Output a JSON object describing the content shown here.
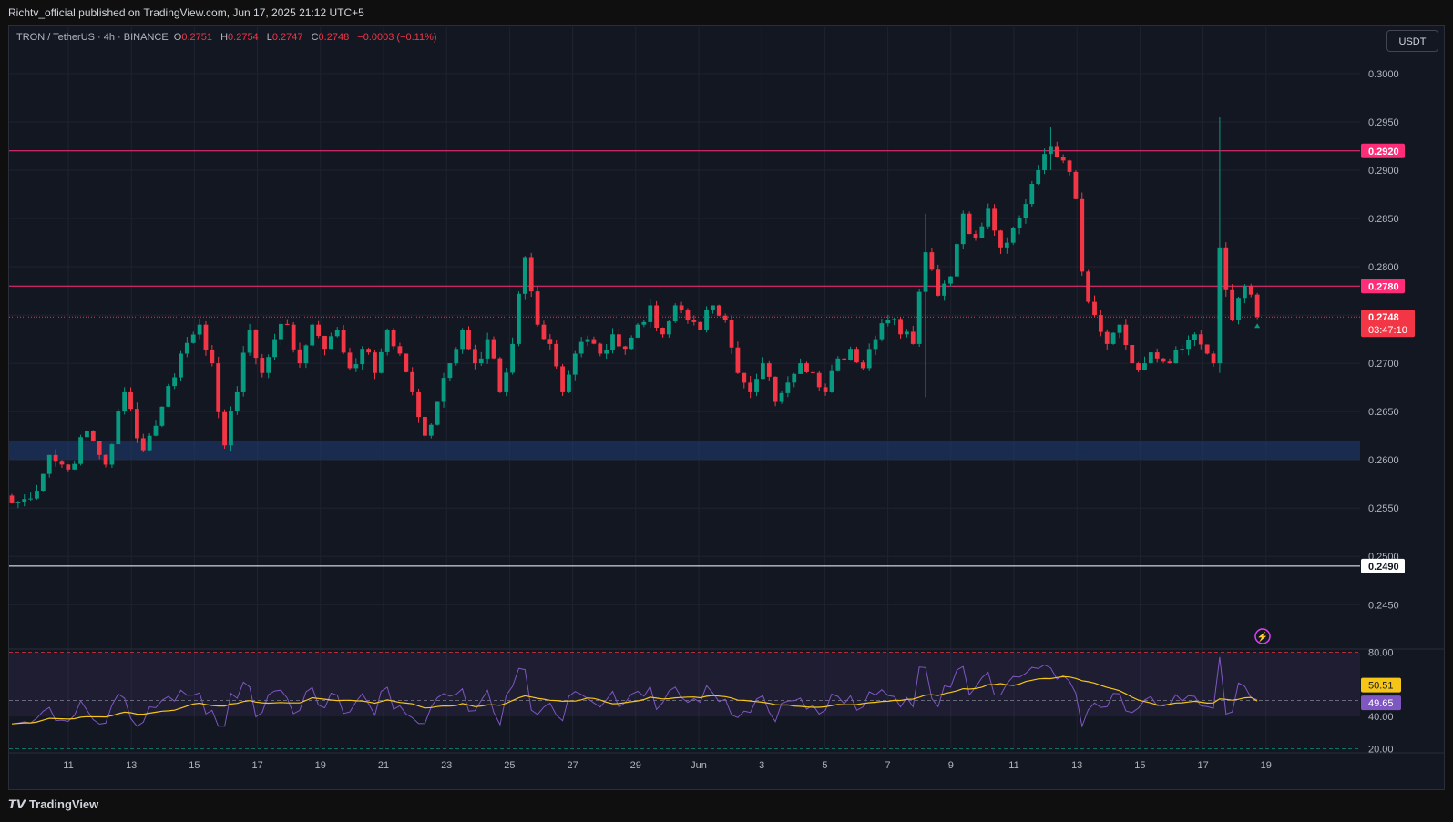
{
  "header": {
    "published": "Richtv_official published on TradingView.com, Jun 17, 2025 21:12 UTC+5"
  },
  "legend": {
    "symbol": "TRON / TetherUS · 4h · BINANCE",
    "o_label": "O",
    "o": "0.2751",
    "h_label": "H",
    "h": "0.2754",
    "l_label": "L",
    "l": "0.2747",
    "c_label": "C",
    "c": "0.2748",
    "change": "−0.0003 (−0.11%)"
  },
  "currency": "USDT",
  "footer": {
    "brand": "TradingView"
  },
  "colors": {
    "up": "#089981",
    "down": "#f23645",
    "bg": "#131722",
    "resistance": "#ff2d78",
    "support_zone": "#1e3a6e",
    "rsi": "#7e57c2",
    "rsi_ma": "#f5c518"
  },
  "chart_data": {
    "type": "candlestick",
    "price_axis": {
      "ylim": [
        0.2405,
        0.3048
      ],
      "ticks": [
        "0.3000",
        "0.2950",
        "0.2900",
        "0.2850",
        "0.2800",
        "0.2750",
        "0.2700",
        "0.2650",
        "0.2600",
        "0.2550",
        "0.2500",
        "0.2450"
      ],
      "labels": [
        {
          "value": 0.292,
          "text": "0.2920",
          "kind": "resistance"
        },
        {
          "value": 0.278,
          "text": "0.2780",
          "kind": "resistance"
        },
        {
          "value": 0.2748,
          "text": "0.2748",
          "countdown": "03:47:10",
          "kind": "last"
        },
        {
          "value": 0.249,
          "text": "0.2490",
          "kind": "white"
        }
      ]
    },
    "x_axis": {
      "ticks": [
        "11",
        "13",
        "15",
        "17",
        "19",
        "21",
        "23",
        "25",
        "27",
        "29",
        "Jun",
        "3",
        "5",
        "7",
        "9",
        "11",
        "13",
        "15",
        "17",
        "19"
      ]
    },
    "horizontal_lines": [
      {
        "value": 0.292,
        "color": "#ff2d78"
      },
      {
        "value": 0.278,
        "color": "#ff2d78"
      },
      {
        "value": 0.249,
        "color": "#ffffff"
      }
    ],
    "zone": {
      "from": 0.26,
      "to": 0.262
    },
    "close_path": [
      [
        0,
        0.2555
      ],
      [
        3,
        0.256
      ],
      [
        6,
        0.2605
      ],
      [
        9,
        0.259
      ],
      [
        12,
        0.263
      ],
      [
        15,
        0.2595
      ],
      [
        18,
        0.267
      ],
      [
        21,
        0.261
      ],
      [
        24,
        0.2655
      ],
      [
        27,
        0.271
      ],
      [
        30,
        0.274
      ],
      [
        32,
        0.27
      ],
      [
        34,
        0.2615
      ],
      [
        36,
        0.267
      ],
      [
        38,
        0.2735
      ],
      [
        40,
        0.269
      ],
      [
        42,
        0.2725
      ],
      [
        44,
        0.274
      ],
      [
        46,
        0.27
      ],
      [
        48,
        0.274
      ],
      [
        50,
        0.2715
      ],
      [
        52,
        0.2735
      ],
      [
        54,
        0.2695
      ],
      [
        56,
        0.2715
      ],
      [
        58,
        0.269
      ],
      [
        60,
        0.2735
      ],
      [
        62,
        0.271
      ],
      [
        64,
        0.267
      ],
      [
        66,
        0.2625
      ],
      [
        68,
        0.266
      ],
      [
        70,
        0.27
      ],
      [
        72,
        0.2735
      ],
      [
        74,
        0.27
      ],
      [
        76,
        0.2725
      ],
      [
        78,
        0.267
      ],
      [
        80,
        0.272
      ],
      [
        82,
        0.281
      ],
      [
        84,
        0.274
      ],
      [
        86,
        0.272
      ],
      [
        88,
        0.267
      ],
      [
        90,
        0.271
      ],
      [
        92,
        0.2725
      ],
      [
        94,
        0.271
      ],
      [
        96,
        0.273
      ],
      [
        98,
        0.2715
      ],
      [
        100,
        0.274
      ],
      [
        102,
        0.276
      ],
      [
        104,
        0.273
      ],
      [
        106,
        0.276
      ],
      [
        108,
        0.2745
      ],
      [
        110,
        0.2735
      ],
      [
        112,
        0.276
      ],
      [
        114,
        0.2745
      ],
      [
        116,
        0.269
      ],
      [
        118,
        0.267
      ],
      [
        120,
        0.27
      ],
      [
        122,
        0.266
      ],
      [
        124,
        0.268
      ],
      [
        126,
        0.27
      ],
      [
        128,
        0.269
      ],
      [
        130,
        0.267
      ],
      [
        132,
        0.2705
      ],
      [
        134,
        0.2715
      ],
      [
        136,
        0.2695
      ],
      [
        138,
        0.2725
      ],
      [
        140,
        0.2745
      ],
      [
        142,
        0.273
      ],
      [
        144,
        0.272
      ],
      [
        146,
        0.2815
      ],
      [
        148,
        0.277
      ],
      [
        150,
        0.279
      ],
      [
        152,
        0.2855
      ],
      [
        154,
        0.283
      ],
      [
        156,
        0.286
      ],
      [
        158,
        0.282
      ],
      [
        160,
        0.284
      ],
      [
        162,
        0.2865
      ],
      [
        164,
        0.29
      ],
      [
        166,
        0.2925
      ],
      [
        168,
        0.291
      ],
      [
        170,
        0.287
      ],
      [
        171,
        0.2795
      ],
      [
        173,
        0.275
      ],
      [
        175,
        0.272
      ],
      [
        177,
        0.274
      ],
      [
        179,
        0.27
      ],
      [
        181,
        0.27
      ],
      [
        183,
        0.2705
      ],
      [
        185,
        0.27
      ],
      [
        187,
        0.2715
      ],
      [
        189,
        0.273
      ],
      [
        191,
        0.271
      ],
      [
        192,
        0.27
      ],
      [
        193,
        0.282
      ],
      [
        195,
        0.2745
      ],
      [
        197,
        0.278
      ],
      [
        199,
        0.2748
      ]
    ],
    "notable_wicks": [
      {
        "index": 146,
        "high": 0.2855,
        "low": 0.2665
      },
      {
        "index": 166,
        "high": 0.2945,
        "low": 0.29
      },
      {
        "index": 193,
        "high": 0.2955,
        "low": 0.269
      }
    ],
    "rsi": {
      "levels": [
        {
          "value": 80,
          "text": "80.00"
        },
        {
          "value": 40,
          "text": "40.00"
        },
        {
          "value": 20,
          "text": "20.00"
        }
      ],
      "ylim": [
        18,
        82
      ],
      "rsi_label": "50.51",
      "ma_label": "49.65",
      "rsi_value": 50.51,
      "ma_value": 49.65
    }
  }
}
